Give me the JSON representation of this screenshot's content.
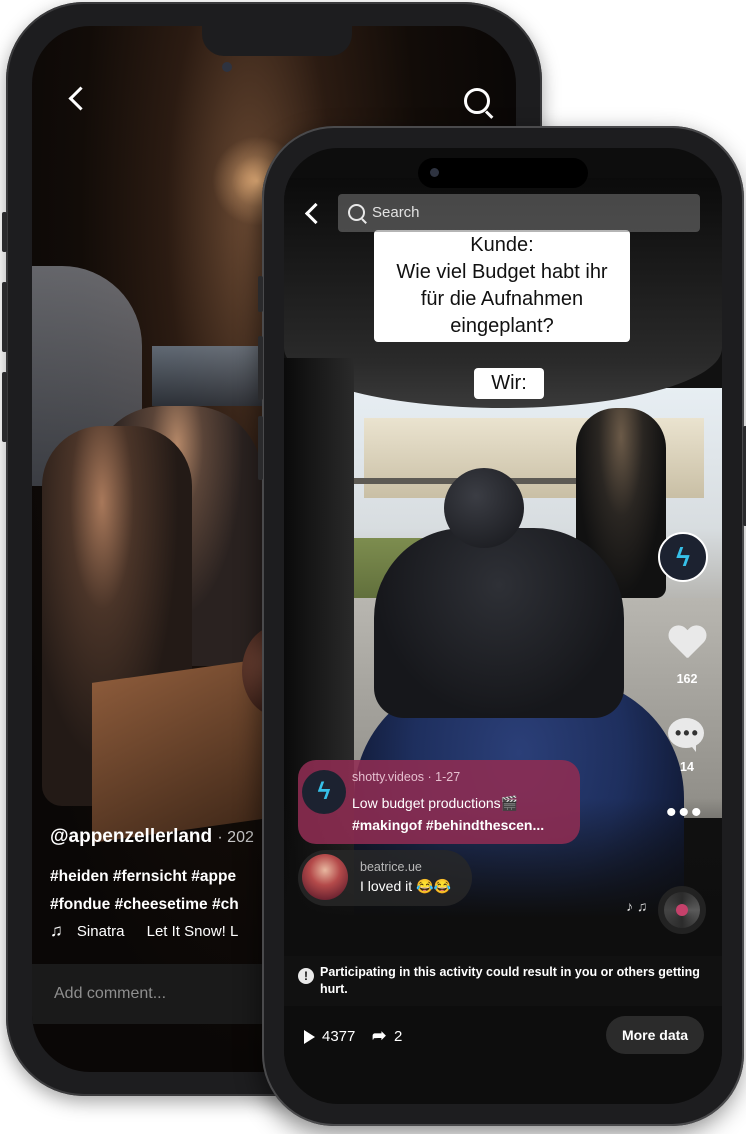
{
  "back_phone": {
    "handle": "@appenzellerland",
    "date": "· 202",
    "hashtags_line1": "#heiden #fernsicht #appe",
    "hashtags_line2": "#fondue #cheesetime #ch",
    "music_artist": "Sinatra",
    "music_title": "Let It Snow! L",
    "comment_placeholder": "Add comment..."
  },
  "front_phone": {
    "search_placeholder": "Search",
    "caption_line1": "Kunde:",
    "caption_line2": "Wie viel Budget habt ihr",
    "caption_line3": "für die Aufnahmen",
    "caption_line4": "eingeplant?",
    "caption_answer": "Wir:",
    "likes": "162",
    "comments": "14",
    "post": {
      "user": "shotty.videos · 1-27",
      "text": "Low budget productions🎬",
      "tags": "#makingof #behindthescen..."
    },
    "reply": {
      "user": "beatrice.ue",
      "text": "I loved it 😂😂"
    },
    "warning": "Participating in this activity could result in you or others getting hurt.",
    "plays": "4377",
    "shares": "2",
    "more_data_label": "More data"
  },
  "icons": {
    "back": "chevron-left-icon",
    "search": "search-icon",
    "like": "heart-icon",
    "comment": "comment-icon",
    "more": "more-icon",
    "play": "play-icon",
    "share": "share-icon",
    "warning": "warning-icon",
    "music": "music-note-icon"
  },
  "colors": {
    "post_card": "#8e2c52",
    "brand_logo": "#36c0e8"
  }
}
